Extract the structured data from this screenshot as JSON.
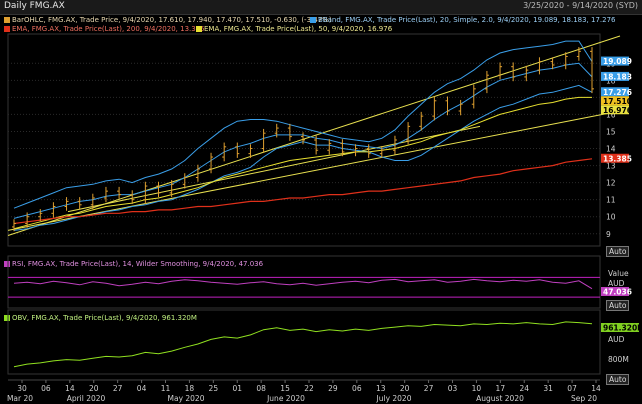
{
  "header": {
    "title": "Daily FMG.AX",
    "date_range": "3/25/2020 - 9/14/2020 (SYD)"
  },
  "legends": {
    "ohlc": "BarOHLC, FMG.AX, Trade Price, 9/4/2020, 17.610, 17.940, 17.470, 17.510, -0.630, (-3.47%)",
    "bband": "BBand, FMG.AX, Trade Price(Last), 20, Simple, 2.0, 9/4/2020, 19.089, 18.183, 17.276",
    "ema200": "EMA, FMG.AX, Trade Price(Last), 200, 9/4/2020, 13.385",
    "ema50": "EMA, FMG.AX, Trade Price(Last), 50, 9/4/2020, 16.976",
    "rsi": "RSI, FMG.AX, Trade Price(Last), 14, Wilder Smoothing, 9/4/2020, 47.036",
    "obv": "OBV, FMG.AX, Trade Price(Last), 9/4/2020, 961.320M"
  },
  "colors": {
    "bar": "#e0a030",
    "bband": "#3a9ee8",
    "ema200": "#e0301a",
    "ema50": "#e8e030",
    "trend": "#e8e050",
    "rsi": "#c040c0",
    "obv": "#90e020",
    "rsi_guide": "#c020c0"
  },
  "axis_buttons": {
    "auto1": "Auto",
    "auto2": "Auto",
    "auto3": "Auto"
  },
  "rsi_axis": {
    "value_label": "Value",
    "unit": "AUD"
  },
  "obv_axis": {
    "unit": "AUD",
    "tick": "800M"
  },
  "price_tags": {
    "bband_upper": "19.089",
    "bband_mid": "18.183",
    "bband_lower": "17.276",
    "close": "17.510",
    "ema50": "16.976",
    "ema200": "13.385"
  },
  "rsi_tag": "47.036",
  "obv_tag": "961.320M",
  "chart_data": {
    "type": "line",
    "title": "Daily FMG.AX",
    "price_axis": {
      "ticks": [
        9,
        10,
        11,
        12,
        13,
        14,
        15,
        16,
        17,
        18,
        19
      ],
      "ylim": [
        8.4,
        20.6
      ]
    },
    "x_axis": {
      "day_ticks": [
        "30",
        "06",
        "14",
        "20",
        "27",
        "04",
        "11",
        "18",
        "25",
        "01",
        "08",
        "15",
        "22",
        "29",
        "06",
        "13",
        "20",
        "27",
        "03",
        "10",
        "17",
        "24",
        "31",
        "07",
        "14"
      ],
      "month_labels": [
        "Mar 20",
        "April 2020",
        "May 2020",
        "June 2020",
        "July 2020",
        "August 2020",
        "Sep 20"
      ]
    },
    "series": [
      {
        "name": "BarOHLC close",
        "values": [
          9.6,
          10.0,
          10.2,
          10.6,
          10.9,
          10.7,
          11.1,
          11.5,
          11.3,
          11.0,
          11.8,
          11.4,
          11.9,
          12.3,
          12.8,
          13.5,
          14.1,
          13.7,
          14.0,
          14.9,
          15.2,
          14.7,
          14.5,
          13.9,
          14.3,
          13.8,
          14.0,
          13.7,
          13.9,
          14.5,
          15.3,
          15.9,
          16.8,
          16.2,
          16.6,
          17.5,
          18.3,
          18.8,
          18.2,
          18.6,
          19.1,
          18.9,
          19.4,
          19.7,
          17.5
        ]
      },
      {
        "name": "BBand upper",
        "values": [
          10.5,
          10.8,
          11.1,
          11.4,
          11.7,
          11.8,
          11.9,
          12.1,
          12.2,
          12.0,
          12.3,
          12.5,
          12.8,
          13.3,
          14.0,
          14.6,
          15.2,
          15.6,
          15.7,
          15.7,
          15.6,
          15.4,
          15.2,
          15.0,
          14.8,
          14.6,
          14.5,
          14.4,
          14.6,
          15.1,
          15.9,
          16.6,
          17.3,
          17.8,
          18.1,
          18.6,
          19.2,
          19.6,
          19.8,
          19.9,
          20.0,
          20.1,
          20.3,
          20.3,
          19.1
        ]
      },
      {
        "name": "BBand mid",
        "values": [
          9.9,
          10.1,
          10.3,
          10.5,
          10.7,
          10.9,
          11.0,
          11.2,
          11.3,
          11.3,
          11.5,
          11.7,
          11.9,
          12.3,
          12.8,
          13.3,
          13.8,
          14.1,
          14.3,
          14.6,
          14.8,
          14.8,
          14.8,
          14.6,
          14.5,
          14.3,
          14.2,
          14.1,
          14.0,
          14.2,
          14.6,
          15.1,
          15.7,
          16.2,
          16.6,
          17.1,
          17.6,
          18.0,
          18.2,
          18.4,
          18.6,
          18.7,
          18.9,
          19.0,
          18.2
        ]
      },
      {
        "name": "BBand lower",
        "values": [
          9.2,
          9.3,
          9.5,
          9.6,
          9.8,
          10.0,
          10.1,
          10.3,
          10.4,
          10.6,
          10.7,
          10.9,
          11.0,
          11.3,
          11.6,
          12.0,
          12.4,
          12.6,
          12.9,
          13.5,
          14.0,
          14.2,
          14.4,
          14.2,
          14.2,
          14.0,
          13.9,
          13.8,
          13.5,
          13.3,
          13.3,
          13.6,
          14.1,
          14.6,
          15.1,
          15.6,
          16.0,
          16.4,
          16.6,
          16.9,
          17.2,
          17.3,
          17.5,
          17.7,
          17.3
        ]
      },
      {
        "name": "EMA 50",
        "values": [
          9.3,
          9.5,
          9.7,
          9.9,
          10.1,
          10.2,
          10.4,
          10.6,
          10.7,
          10.8,
          11.0,
          11.1,
          11.3,
          11.5,
          11.7,
          12.0,
          12.3,
          12.5,
          12.7,
          12.9,
          13.1,
          13.3,
          13.4,
          13.5,
          13.6,
          13.7,
          13.8,
          13.8,
          13.9,
          14.0,
          14.2,
          14.4,
          14.7,
          14.9,
          15.1,
          15.4,
          15.7,
          16.0,
          16.2,
          16.4,
          16.6,
          16.7,
          16.9,
          17.0,
          17.0
        ]
      },
      {
        "name": "EMA 200",
        "values": [
          9.6,
          9.7,
          9.8,
          9.9,
          10.0,
          10.0,
          10.1,
          10.2,
          10.2,
          10.3,
          10.3,
          10.4,
          10.4,
          10.5,
          10.6,
          10.6,
          10.7,
          10.8,
          10.9,
          10.9,
          11.0,
          11.1,
          11.1,
          11.2,
          11.3,
          11.3,
          11.4,
          11.5,
          11.5,
          11.6,
          11.7,
          11.8,
          11.9,
          12.0,
          12.1,
          12.3,
          12.4,
          12.5,
          12.7,
          12.8,
          12.9,
          13.0,
          13.2,
          13.3,
          13.4
        ]
      }
    ],
    "rsi_values": [
      58,
      60,
      57,
      62,
      59,
      55,
      61,
      58,
      53,
      56,
      60,
      57,
      62,
      65,
      63,
      60,
      58,
      56,
      59,
      61,
      57,
      55,
      58,
      54,
      57,
      60,
      62,
      59,
      64,
      66,
      61,
      63,
      65,
      60,
      62,
      66,
      63,
      61,
      64,
      62,
      65,
      60,
      58,
      63,
      47
    ],
    "obv_values": [
      300,
      340,
      360,
      390,
      410,
      400,
      430,
      460,
      450,
      470,
      520,
      500,
      540,
      600,
      650,
      720,
      760,
      740,
      790,
      870,
      900,
      860,
      880,
      840,
      870,
      850,
      880,
      860,
      890,
      910,
      930,
      920,
      950,
      940,
      930,
      960,
      950,
      970,
      960,
      980,
      960,
      950,
      990,
      980,
      961
    ]
  }
}
